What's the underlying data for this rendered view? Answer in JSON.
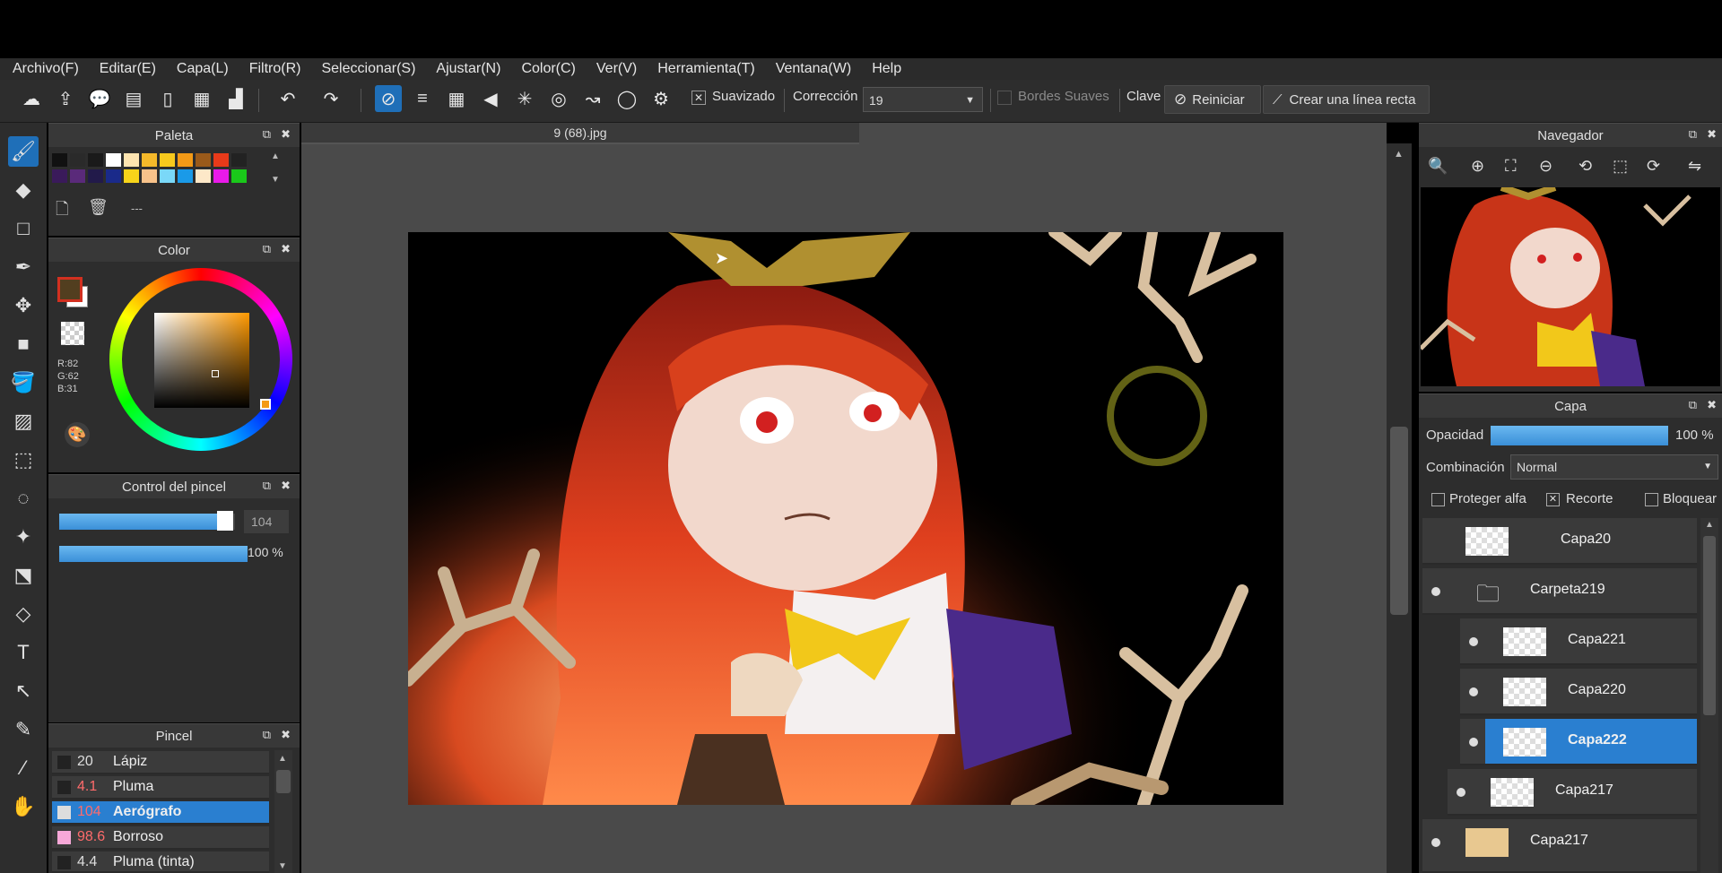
{
  "menu": [
    "Archivo(F)",
    "Editar(E)",
    "Capa(L)",
    "Filtro(R)",
    "Seleccionar(S)",
    "Ajustar(N)",
    "Color(C)",
    "Ver(V)",
    "Herramienta(T)",
    "Ventana(W)",
    "Help"
  ],
  "toolbar": {
    "suavizado": "Suavizado",
    "correccion_label": "Corrección",
    "correccion_value": "19",
    "bordes": "Bordes Suaves",
    "clave": "Clave",
    "reiniciar": "Reiniciar",
    "linea_recta": "Crear una línea recta"
  },
  "palette": {
    "title": "Paleta",
    "divider": "---"
  },
  "color": {
    "title": "Color",
    "r": "R:82",
    "g": "G:62",
    "b": "B:31",
    "fg": "#523e1f",
    "bg": "#ffffff"
  },
  "brush_control": {
    "title": "Control del pincel",
    "size": "104",
    "opacity": "100 %",
    "size_fill": 0.9,
    "opacity_fill": 1.0
  },
  "brush": {
    "title": "Pincel",
    "items": [
      {
        "size": "20",
        "name": "Lápiz",
        "color": "#222222",
        "red": false
      },
      {
        "size": "4.1",
        "name": "Pluma",
        "color": "#222222",
        "red": true
      },
      {
        "size": "104",
        "name": "Aerógrafo",
        "color": "#dddddd",
        "red": true
      },
      {
        "size": "98.6",
        "name": "Borroso",
        "color": "#f7a8d8",
        "red": true
      },
      {
        "size": "4.4",
        "name": "Pluma (tinta)",
        "color": "#222222",
        "red": false
      }
    ]
  },
  "document": {
    "tab": "9 (68).jpg"
  },
  "navigator": {
    "title": "Navegador"
  },
  "layer": {
    "title": "Capa",
    "opacity_label": "Opacidad",
    "opacity_value": "100 %",
    "opacity_fill": 1.0,
    "blend_label": "Combinación",
    "blend_value": "Normal",
    "protect_alpha": "Proteger alfa",
    "clip": "Recorte",
    "lock": "Bloquear",
    "items": [
      "Capa20",
      "Carpeta219",
      "Capa221",
      "Capa220",
      "Capa222",
      "Capa217",
      "Capa217"
    ]
  }
}
